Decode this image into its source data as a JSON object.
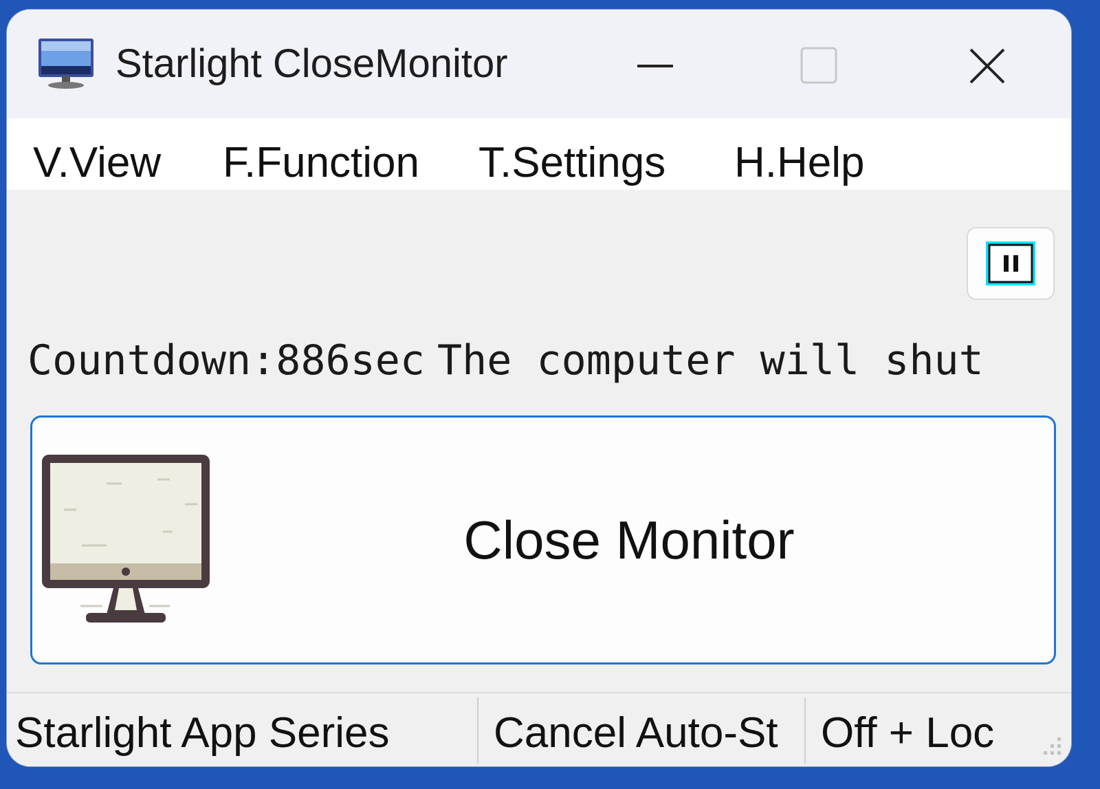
{
  "window": {
    "title": "Starlight CloseMonitor"
  },
  "menu": [
    {
      "label": "V.View"
    },
    {
      "label": "F.Function"
    },
    {
      "label": "T.Settings"
    },
    {
      "label": "H.Help"
    }
  ],
  "countdown": {
    "prefix": "Countdown: ",
    "seconds": "886",
    "unit": " sec",
    "message": "The computer will shut"
  },
  "main_button": {
    "label": "Close Monitor",
    "icon": "monitor-icon"
  },
  "pause_button": {
    "icon": "pause-icon"
  },
  "status_bar": {
    "panes": [
      {
        "text": "Starlight App Series"
      },
      {
        "text": "Cancel Auto-St"
      },
      {
        "text": "Off + Loc"
      }
    ]
  },
  "colors": {
    "accent": "#1f74d2",
    "desktop": "#1f56b8",
    "pause_highlight": "#00e5ff"
  }
}
